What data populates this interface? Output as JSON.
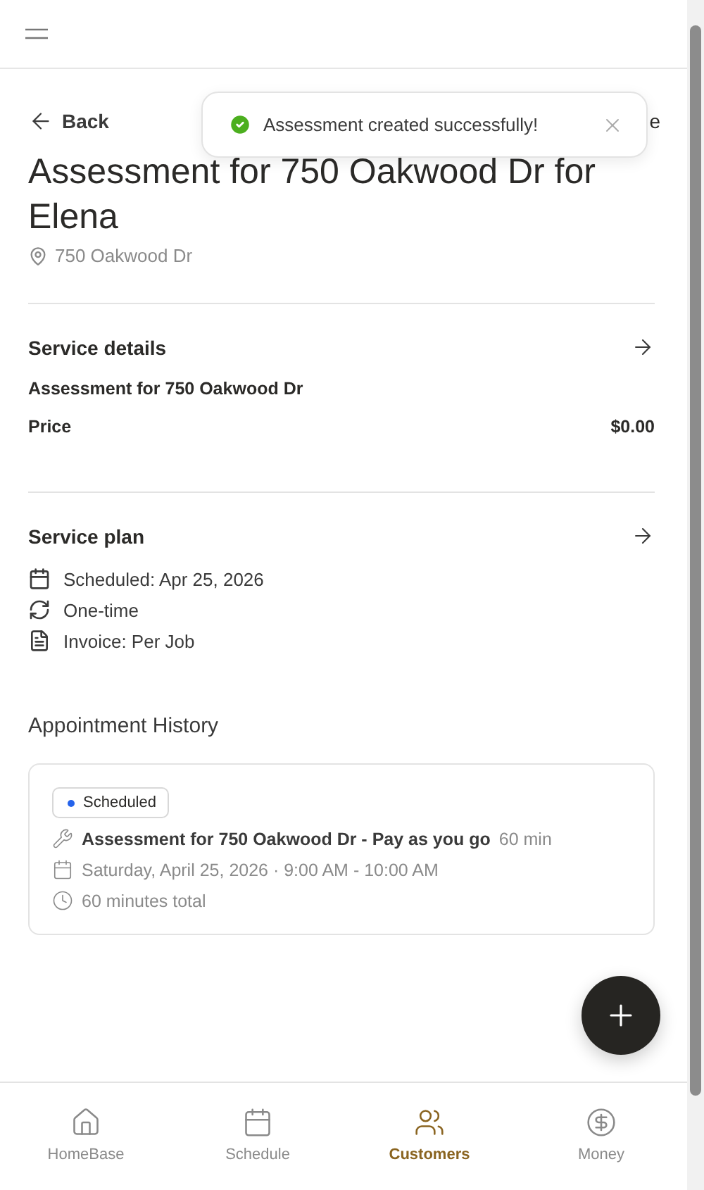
{
  "header": {
    "back": "Back",
    "action_partial": "e"
  },
  "toast": {
    "message": "Assessment created successfully!"
  },
  "title": "Assessment for 750 Oakwood Dr for Elena",
  "address": "750 Oakwood Dr",
  "service_details": {
    "heading": "Service details",
    "name": "Assessment for 750 Oakwood Dr",
    "price_label": "Price",
    "price": "$0.00"
  },
  "service_plan": {
    "heading": "Service plan",
    "items": [
      {
        "kind": "calendar",
        "text": "Scheduled: Apr 25, 2026"
      },
      {
        "kind": "repeat",
        "text": "One-time"
      },
      {
        "kind": "invoice",
        "text": "Invoice: Per Job"
      }
    ]
  },
  "appointment_history": {
    "heading": "Appointment History",
    "appointments": [
      {
        "status": "Scheduled",
        "color": "#2563eb",
        "title": "Assessment for 750 Oakwood Dr - Pay as you go",
        "duration": "60 min",
        "when": "Saturday, April 25, 2026 · 9:00 AM - 10:00 AM",
        "total": "60 minutes total"
      }
    ]
  },
  "nav": [
    {
      "kind": "home",
      "label": "HomeBase",
      "selected": false
    },
    {
      "kind": "schedule",
      "label": "Schedule",
      "selected": false
    },
    {
      "kind": "customers",
      "label": "Customers",
      "selected": true
    },
    {
      "kind": "money",
      "label": "Money",
      "selected": false
    }
  ]
}
